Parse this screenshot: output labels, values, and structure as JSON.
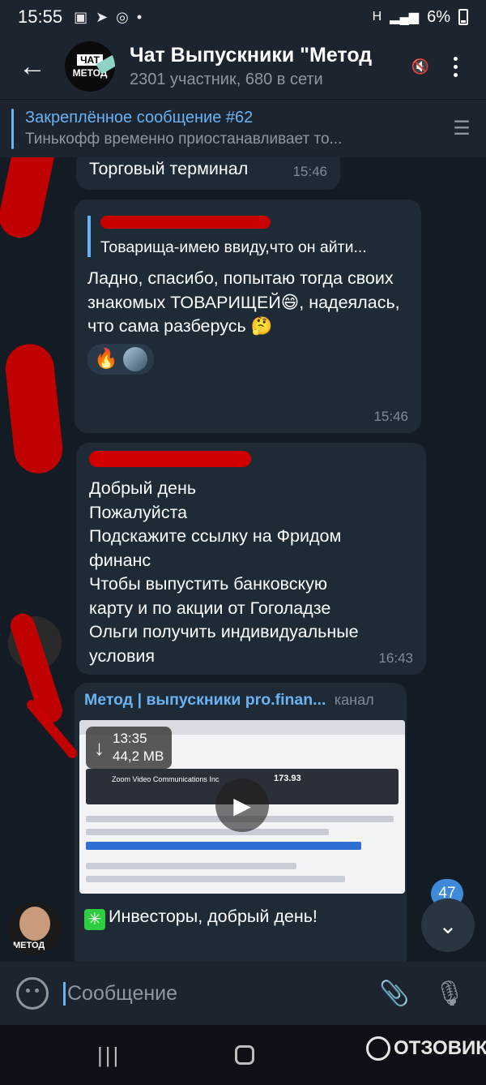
{
  "status": {
    "time": "15:55",
    "network": "H",
    "battery": "6%"
  },
  "header": {
    "avatar_top": "ЧАТ",
    "avatar_bottom": "МЕТОД",
    "title": "Чат Выпускники \"Метод",
    "subtitle": "2301 участник, 680 в сети"
  },
  "pinned": {
    "title": "Закреплённое сообщение #62",
    "body": "Тинькофф временно приостанавливает то..."
  },
  "messages": [
    {
      "text": "Торговый терминал",
      "time": "15:46"
    },
    {
      "reply_text": "Товарища-имею ввиду,что он айти...",
      "text": "Ладно, спасибо, попытаю тогда своих знакомых ТОВАРИЩЕЙ😄, надеялась, что сама разберусь 🤔",
      "reaction_emoji": "🔥",
      "time": "15:46"
    },
    {
      "lines": [
        "Добрый день",
        "Пожалуйста",
        "Подскажите ссылку на Фридом",
        "финанс",
        "Чтобы выпустить банковскую",
        "карту и по акции от Гоголадзе",
        "Ольги получить индивидуальные",
        "условия"
      ],
      "time": "16:43"
    },
    {
      "channel_name": "Метод | выпускники pro.finan...",
      "channel_label": "канал",
      "video_duration": "13:35",
      "video_size": "44,2 MB",
      "video_company": "Zoom Video Communications Inc",
      "video_price": "173.93",
      "text": "Инвесторы, добрый день!",
      "avatar_label": "МЕТОД"
    }
  ],
  "unread_count": "47",
  "input": {
    "placeholder": "Сообщение"
  },
  "watermark": "ОТЗОВИК"
}
